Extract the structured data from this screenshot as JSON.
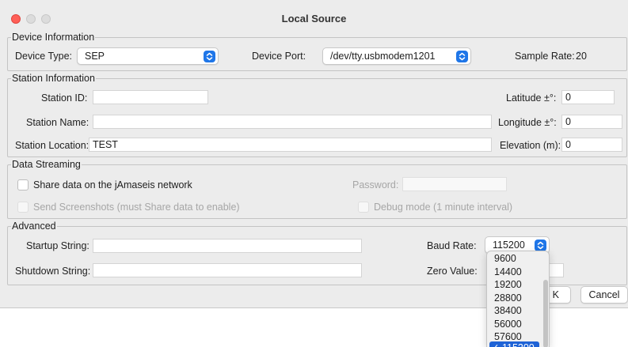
{
  "window": {
    "title": "Local Source"
  },
  "device": {
    "legend": "Device Information",
    "type_label": "Device Type:",
    "type_value": "SEP",
    "port_label": "Device Port:",
    "port_value": "/dev/tty.usbmodem1201",
    "sample_rate_label": "Sample Rate:",
    "sample_rate_value": "20"
  },
  "station": {
    "legend": "Station Information",
    "id_label": "Station ID:",
    "id_value": "",
    "name_label": "Station Name:",
    "name_value": "",
    "location_label": "Station Location:",
    "location_value": "TEST",
    "latitude_label": "Latitude ±°:",
    "latitude_value": "0",
    "longitude_label": "Longitude ±°:",
    "longitude_value": "0",
    "elevation_label": "Elevation (m):",
    "elevation_value": "0"
  },
  "streaming": {
    "legend": "Data Streaming",
    "share_label": "Share data on the jAmaseis network",
    "password_label": "Password:",
    "password_value": "",
    "screenshots_label": "Send Screenshots (must Share data to enable)",
    "debug_label": "Debug mode (1 minute interval)"
  },
  "advanced": {
    "legend": "Advanced",
    "startup_label": "Startup String:",
    "startup_value": "",
    "shutdown_label": "Shutdown String:",
    "shutdown_value": "",
    "baud_label": "Baud Rate:",
    "baud_value": "115200",
    "zero_label": "Zero Value:",
    "baud_options": [
      "9600",
      "14400",
      "19200",
      "28800",
      "38400",
      "56000",
      "57600",
      "115200"
    ],
    "selected_check": "✓"
  },
  "buttons": {
    "ok_label": "K",
    "cancel_label": "Cancel"
  },
  "colors": {
    "accent": "#1f76e8",
    "selection": "#1f63d6",
    "close": "#ff5f57"
  }
}
